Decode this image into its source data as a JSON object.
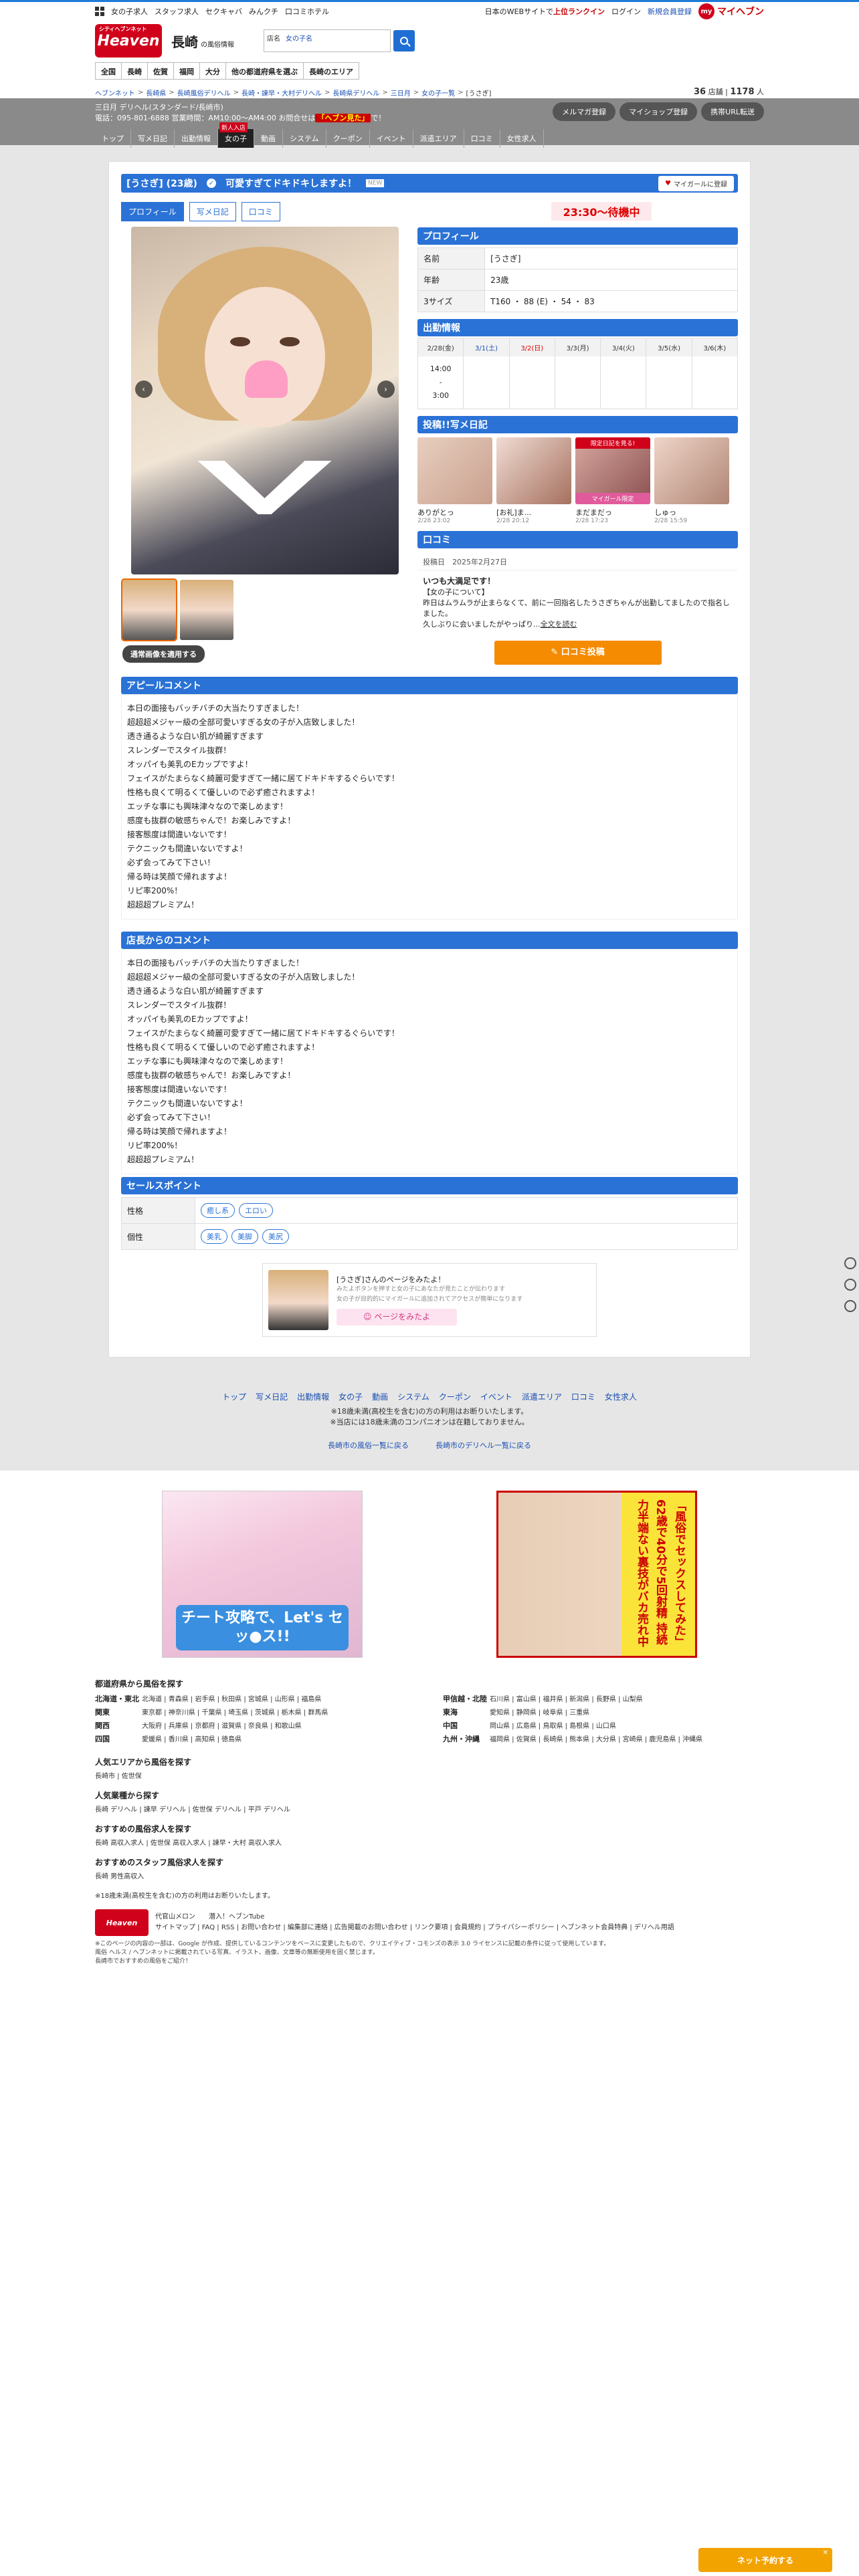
{
  "topbar": {
    "links": [
      "女の子求人",
      "スタッフ求人",
      "セクキャバ",
      "みんクチ",
      "口コミホテル"
    ],
    "right_notice_prefix": "日本のWEBサイトで",
    "right_notice_hi": "上位ランクイン",
    "login": "ログイン",
    "signup": "新規会員登録",
    "my_label": "my",
    "myheaven": "マイヘブン"
  },
  "header": {
    "logo_small": "シティヘブンネット",
    "logo": "Heaven",
    "area": "長崎",
    "area_sub": "の風俗情報",
    "search_label": "店名",
    "search_placeholder": "女の子名"
  },
  "gnav": [
    "全国",
    "長崎",
    "佐賀",
    "福岡",
    "大分",
    "他の都道府県を選ぶ",
    "長崎のエリア"
  ],
  "counts": {
    "shops": "36",
    "shops_unit": "店舗",
    "girls": "1178",
    "girls_unit": "人"
  },
  "breadcrumb": [
    "ヘブンネット",
    "長崎県",
    "長崎風俗デリヘル",
    "長崎・諫早・大村デリヘル",
    "長崎県デリヘル",
    "三日月",
    "女の子一覧",
    "[うさぎ]"
  ],
  "shop": {
    "name": "三日月 デリヘル(スタンダード/長崎市)",
    "tel_line": "電話：095-801-6888 営業時間：AM10:00〜AM4:00 お問合せは",
    "tel_hi": "「ヘブン見た」",
    "tel_suffix": "で！",
    "buttons": [
      "メルマガ登録",
      "マイショップ登録",
      "携帯URL転送"
    ]
  },
  "subnav": {
    "items": [
      "トップ",
      "写メ日記",
      "出勤情報",
      "女の子",
      "動画",
      "システム",
      "クーポン",
      "イベント",
      "派遣エリア",
      "口コミ",
      "女性求人"
    ],
    "active": "女の子",
    "new_tag": "新人入店"
  },
  "girl": {
    "name": "[うさぎ]",
    "age_label": "(23歳)",
    "check": "✓",
    "catch": "可愛すぎてドキドキしますよ！",
    "small": "NEW",
    "mygirl_heart": "♥",
    "mygirl": "マイガールに登録"
  },
  "profile_tabs": [
    "プロフィール",
    "写メ日記",
    "口コミ"
  ],
  "status_time": "23:30〜待機中",
  "photo": {
    "prev": "‹",
    "next": "›",
    "change_button": "通常画像を適用する"
  },
  "profile": {
    "heading": "プロフィール",
    "rows": [
      {
        "k": "名前",
        "v": "[うさぎ]"
      },
      {
        "k": "年齢",
        "v": "23歳"
      },
      {
        "k": "3サイズ",
        "v": "T160 ・ 88 (E) ・ 54 ・ 83"
      }
    ]
  },
  "schedule": {
    "heading": "出勤情報",
    "days": [
      {
        "d": "2/28(金)",
        "v": "14:00\n-\n3:00"
      },
      {
        "d": "3/1(土)",
        "v": ""
      },
      {
        "d": "3/2(日)",
        "v": ""
      },
      {
        "d": "3/3(月)",
        "v": ""
      },
      {
        "d": "3/4(火)",
        "v": ""
      },
      {
        "d": "3/5(水)",
        "v": ""
      },
      {
        "d": "3/6(木)",
        "v": ""
      }
    ]
  },
  "diary": {
    "heading": "投稿!!写メ日記",
    "locked_label": "限定日記を見る!",
    "mygirl_only": "マイガール限定",
    "items": [
      {
        "title": "ありがとっ",
        "date": "2/28 23:02"
      },
      {
        "title": "[お礼]ま...",
        "date": "2/28 20:12"
      },
      {
        "title": "まだまだっ",
        "date": "2/28 17:23"
      },
      {
        "title": "しゅっ",
        "date": "2/28 15:59"
      }
    ]
  },
  "reviews": {
    "heading": "口コミ",
    "date_label": "投稿日",
    "date": "2025年2月27日",
    "title": "いつも大満足です！",
    "body1": "【女の子について】",
    "body2": "昨日はムラムラが止まらなくて、前に一回指名したうさぎちゃんが出勤してましたので指名しました。",
    "body3": "久しぶりに会いましたがやっぱり...",
    "read_more": "全文を読む",
    "post_button": "✎ 口コミ投稿"
  },
  "appeal": {
    "heading": "アピールコメント",
    "lines": [
      "本日の面接もバッチバチの大当たりすぎました！",
      "超超超メジャー級の全部可愛いすぎる女の子が入店致しました！",
      "透き通るような白い肌が綺麗すぎます",
      "スレンダーでスタイル抜群！",
      "オッパイも美乳のEカップですよ！",
      "フェイスがたまらなく綺麗可愛すぎて一緒に居てドキドキするぐらいです！",
      "性格も良くて明るくて優しいので必ず癒されますよ！",
      "エッチな事にも興味津々なので楽しめます！",
      "感度も抜群の敏感ちゃんで！お楽しみですよ！",
      "接客態度は間違いないです！",
      "テクニックも間違いないですよ！",
      "必ず会ってみて下さい！",
      "帰る時は笑顔で帰れますよ！",
      "リピ率200%！",
      "超超超プレミアム！"
    ]
  },
  "shop_comment": {
    "heading": "店長からのコメント",
    "lines": [
      "本日の面接もバッチバチの大当たりすぎました！",
      "超超超メジャー級の全部可愛いすぎる女の子が入店致しました！",
      "透き通るような白い肌が綺麗すぎます",
      "スレンダーでスタイル抜群！",
      "オッパイも美乳のEカップですよ！",
      "フェイスがたまらなく綺麗可愛すぎて一緒に居てドキドキするぐらいです！",
      "性格も良くて明るくて優しいので必ず癒されますよ！",
      "エッチな事にも興味津々なので楽しめます！",
      "感度も抜群の敏感ちゃんで！お楽しみですよ！",
      "接客態度は間違いないです！",
      "テクニックも間違いないですよ！",
      "必ず会ってみて下さい！",
      "帰る時は笑顔で帰れますよ！",
      "リピ率200%！",
      "超超超プレミアム！"
    ]
  },
  "sales": {
    "heading": "セールスポイント",
    "rows": [
      {
        "k": "性格",
        "tags": [
          "癒し系",
          "エロい"
        ]
      },
      {
        "k": "個性",
        "tags": [
          "美乳",
          "美脚",
          "美尻"
        ]
      }
    ]
  },
  "promo": {
    "title": "[うさぎ]さんのページをみたよ！",
    "sub1": "みたよボタンを押すと女の子にあなたが見たことが伝わります",
    "sub2": "女の子が目的的にマイガールに追加されてアクセスが簡単になります",
    "button": "☺ ページをみたよ"
  },
  "footer_nav": {
    "links": [
      "トップ",
      "写メ日記",
      "出勤情報",
      "女の子",
      "動画",
      "システム",
      "クーポン",
      "イベント",
      "派遣エリア",
      "口コミ",
      "女性求人"
    ],
    "note1": "※18歳未満(高校生を含む)の方の利用はお断りいたします。",
    "note2": "※当店には18歳未満のコンパニオンは在籍しておりません。",
    "more1": "長崎市の風俗一覧に戻る",
    "more2": "長崎市のデリヘル一覧に戻る"
  },
  "banners": {
    "left_text": "チート攻略で、Let's セッ●ス!!",
    "right_text": "「風俗でセックスしてみた」62歳で40分で5回射精 持続力半端ない裏技がバカ売れ中"
  },
  "site_footer": {
    "pref_heading": "都道府県から風俗を探す",
    "left_regions": [
      {
        "r": "北海道・東北",
        "p": "北海道 | 青森県 | 岩手県 | 秋田県 | 宮城県 | 山形県 | 福島県"
      },
      {
        "r": "関東",
        "p": "東京都 | 神奈川県 | 千葉県 | 埼玉県 | 茨城県 | 栃木県 | 群馬県"
      },
      {
        "r": "関西",
        "p": "大阪府 | 兵庫県 | 京都府 | 滋賀県 | 奈良県 | 和歌山県"
      },
      {
        "r": "四国",
        "p": "愛媛県 | 香川県 | 高知県 | 徳島県"
      }
    ],
    "right_regions": [
      {
        "r": "甲信越・北陸",
        "p": "石川県 | 富山県 | 福井県 | 新潟県 | 長野県 | 山梨県"
      },
      {
        "r": "東海",
        "p": "愛知県 | 静岡県 | 岐阜県 | 三重県"
      },
      {
        "r": "中国",
        "p": "岡山県 | 広島県 | 鳥取県 | 島根県 | 山口県"
      },
      {
        "r": "九州・沖縄",
        "p": "福岡県 | 佐賀県 | 長崎県 | 熊本県 | 大分県 | 宮崎県 | 鹿児島県 | 沖縄県"
      }
    ],
    "popular_area_heading": "人気エリアから風俗を探す",
    "popular_area": "長崎市 | 佐世保",
    "popular_type_heading": "人気業種から探す",
    "popular_type": "長崎 デリヘル | 諫早 デリヘル | 佐世保 デリヘル | 平戸 デリヘル",
    "recruit_heading": "おすすめの風俗求人を探す",
    "recruit": "長崎 高収入求人 | 佐世保 高収入求人 | 諫早・大村 高収入求人",
    "staff_heading": "おすすめのスタッフ風俗求人を探す",
    "staff": "長崎 男性高収入",
    "age_note": "※18歳未満(高校生を含む)の方の利用はお断りいたします。",
    "sponsor1": "代官山メロン",
    "sponsor2": "潜入！ヘブンTube",
    "links": "サイトマップ | FAQ | RSS | お問い合わせ | 編集部に連絡 | 広告掲載のお問い合わせ | リンク要項 | 会員規約 | プライバシーポリシー | ヘブンネット会員特典 | デリヘル用語",
    "legal1": "※このページの内容の一部は、Google が作成、提供しているコンテンツをベースに変更したもので、クリエイティブ・コモンズの表示 3.0 ライセンスに記載の条件に従って使用しています。",
    "legal2": "風俗 ヘルス / ヘブンネットに掲載されている写真、イラスト、画像、文章等の無断使用を固く禁じます。",
    "legal3": "長崎市でおすすめの風俗をご紹介！"
  },
  "floating": {
    "label": "ネット予約する",
    "close": "✕"
  }
}
